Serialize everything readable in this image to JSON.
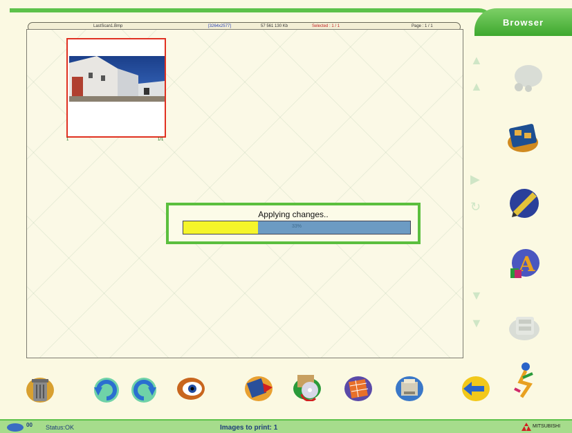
{
  "tab": {
    "label": "Browser"
  },
  "info_bar": {
    "filename": "LastScan1.Bmp",
    "dimensions": "[3264x2577]",
    "filesize": "57 561 130 Kb",
    "selected": "Selected : 1 / 1",
    "page": "Page : 1 / 1"
  },
  "thumbnail": {
    "index": "1",
    "selected_marker": "1/1"
  },
  "progress": {
    "label": "Applying changes..",
    "percent_text": "33%",
    "fraction": 0.33
  },
  "status": {
    "code": "00",
    "status_text": "Status:OK",
    "images_to_print": "Images to print: 1",
    "brand": "MITSUBISHI"
  },
  "colors": {
    "accent_green": "#5dc24a",
    "bar_yellow": "#f5f52a",
    "bar_blue": "#6c9bc3"
  }
}
